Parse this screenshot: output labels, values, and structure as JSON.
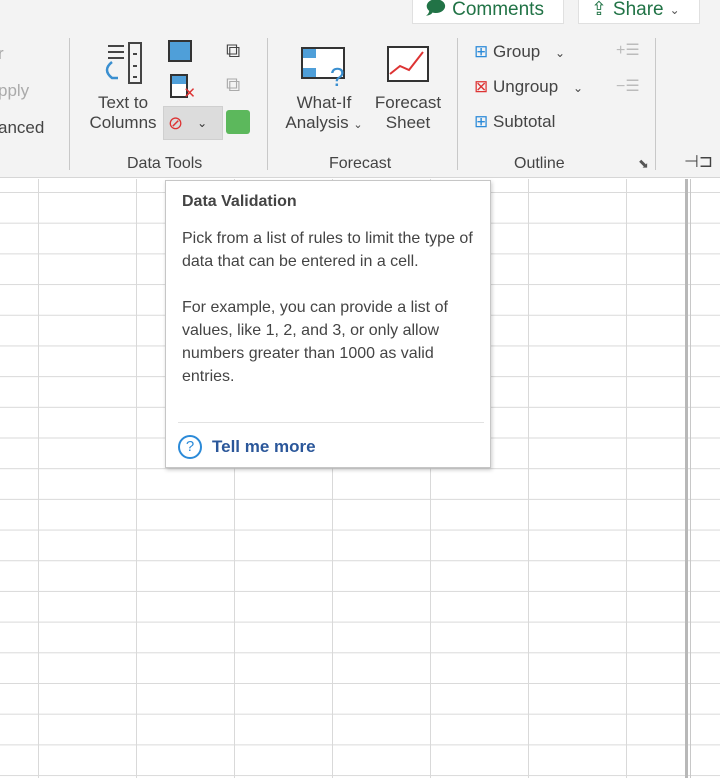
{
  "top": {
    "comments": "Comments",
    "share": "Share"
  },
  "left_partial": {
    "r1": "r",
    "r2": "pply",
    "r3": "anced"
  },
  "data_tools": {
    "text_to_columns_1": "Text to",
    "text_to_columns_2": "Columns",
    "group_label": "Data Tools"
  },
  "forecast": {
    "whatif_1": "What-If",
    "whatif_2": "Analysis",
    "sheet_1": "Forecast",
    "sheet_2": "Sheet",
    "group_label": "Forecast"
  },
  "outline": {
    "group": "Group",
    "ungroup": "Ungroup",
    "subtotal": "Subtotal",
    "group_label": "Outline"
  },
  "tooltip": {
    "title": "Data Validation",
    "p1": "Pick from a list of rules to limit the type of data that can be entered in a cell.",
    "p2": "For example, you can provide a list of values, like 1, 2, and 3, or only allow numbers greater than 1000 as valid entries.",
    "link": "Tell me more"
  }
}
